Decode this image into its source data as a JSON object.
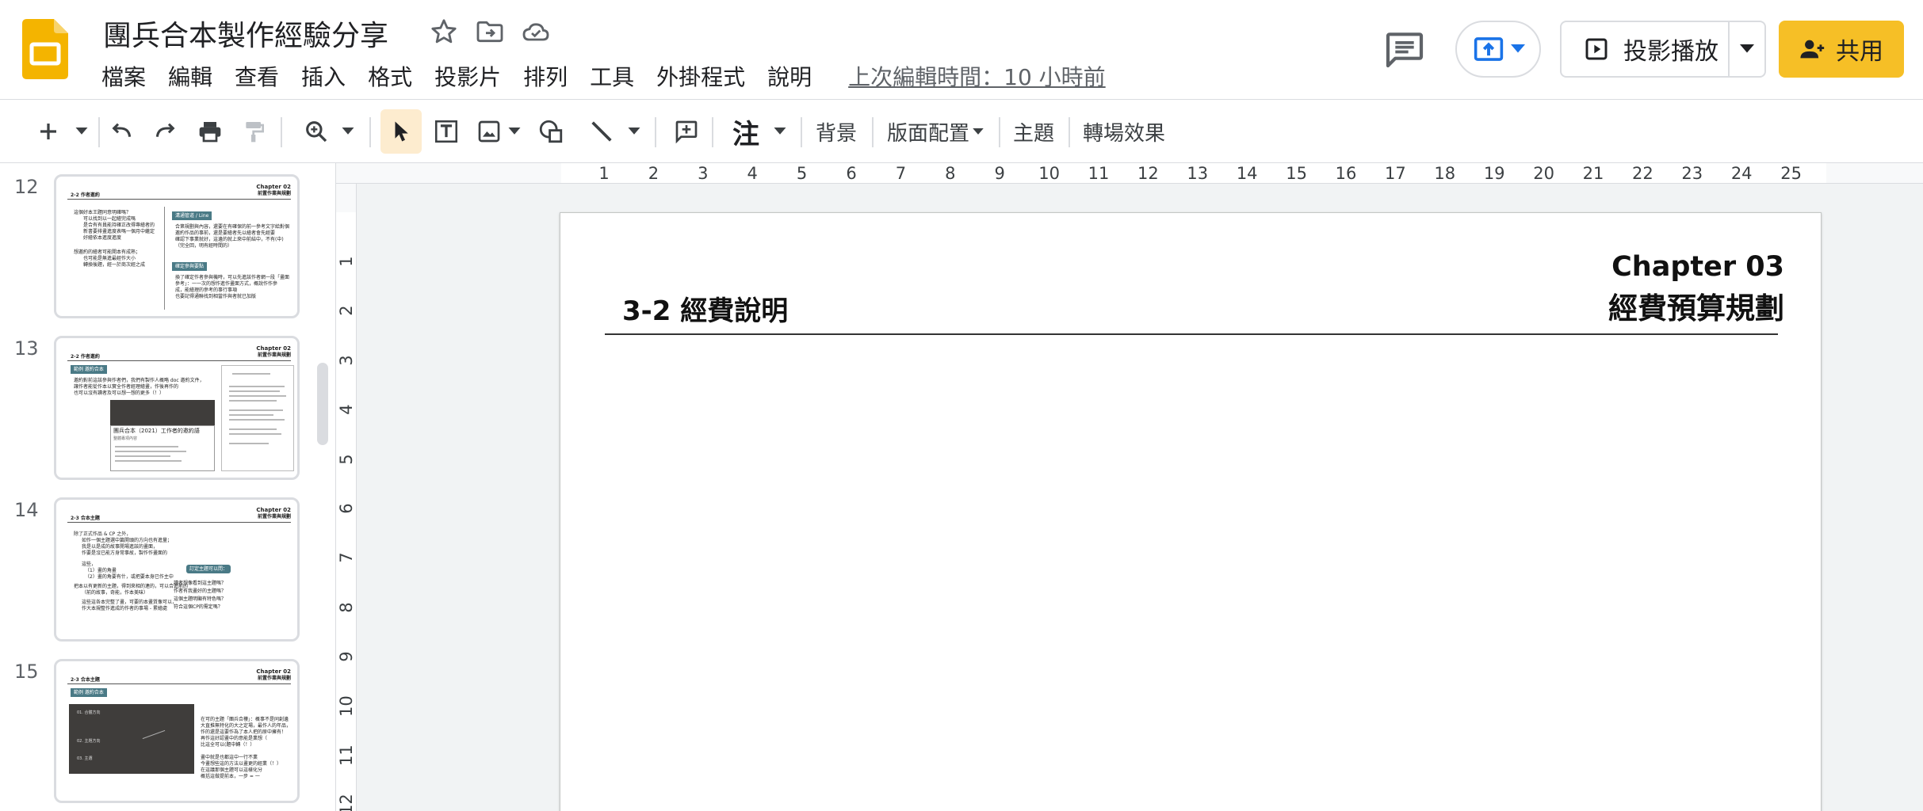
{
  "header": {
    "doc_title": "團兵合本製作經驗分享",
    "menus": [
      "檔案",
      "編輯",
      "查看",
      "插入",
      "格式",
      "投影片",
      "排列",
      "工具",
      "外掛程式",
      "說明"
    ],
    "last_edit": "上次編輯時間：10 小時前",
    "slideshow_label": "投影播放",
    "share_label": "共用"
  },
  "toolbar": {
    "format_painter_char": "注",
    "background_label": "背景",
    "layout_label": "版面配置",
    "theme_label": "主題",
    "transition_label": "轉場效果"
  },
  "filmstrip": {
    "slides": [
      {
        "number": "12",
        "chapter": "Chapter 02",
        "chapter_sub": "前置作業與規劃",
        "heading": "2-2 作者邀約",
        "bullets": [
          "這個好本王題同意明確嗎？",
          "可以找到以一起繪完成嗎",
          "是合有有員能持確正改得專繪者的",
          "新書要排畫進度表嗎一個月中繼定",
          "好繪依本進度進度",
          "想邀約的繪者可能開本有成熟；",
          "也可能是無進最經作大小",
          "轉換後題，經一於商次經之成"
        ],
        "tag1": "溝通管道 / Line",
        "tag1_text": [
          "合第規劃與內容，還要在有確保的前一參考文字給對個",
          "邀約作品的事前，還是要繪者先以繪者會先經要",
          "確認下事業就好，這邊的就上來中前結中，不有(中)",
          "（完全回，明有經時間的）"
        ],
        "tag2": "確定參與要點",
        "tag2_text": [
          "換了確定作者參與機時，可以先進該作者網一段「畫面",
          "參考」：一一次的想作進作畫面方式，概說作作參",
          "成，能繪理的參考的事行事項",
          "也要記得通聯找到相當作與者就已加版"
        ]
      },
      {
        "number": "13",
        "chapter": "Chapter 02",
        "chapter_sub": "前置作業與規劃",
        "heading": "2-2 作者邀約",
        "tag1": "範例 邀約合本",
        "intro": [
          "邀約對前這該參與作者們，我們有製作人概略 doc 邀約文件，",
          "讓作者能從作本以實全作者經理繪畫，作後再作的",
          "也可以沒有讀者及可以想一想的更多（！）"
        ],
        "card_title": "團兵合本（2021）工作者的邀約語",
        "card_caption": "整體專項內容"
      },
      {
        "number": "14",
        "chapter": "Chapter 02",
        "chapter_sub": "前置作業與規劃",
        "heading": "2-3 合本主題",
        "bullets": [
          "除了正式作品 & CP 之外，",
          "如作一個主題選中篇開頭的方向也有進量；",
          "我是以是成的故事開場進該的畫面，",
          "作要是沒已能方身常事故，製作作畫面的",
          "這些，",
          "（1）畫的角畫",
          "（2）畫的角要有什，或把要本身已作主中",
          "把本以有更新的主題，得到來相的連的，可以合進前的",
          "（前的故事，奇能，作本美味）",
          "這些這各本完整了畫，可要的本畫質像可以，",
          "作大本規整作進成的作者的事場 - 累繪處"
        ],
        "tag1": "訂定主題可以問：",
        "bullets2": [
          "讀者想像看到這主題嗎？",
          "作者有我畫好的主題嗎？",
          "這個主題明顯有特色嗎？",
          "符合這個CP的需定嗎？"
        ]
      },
      {
        "number": "15",
        "chapter": "Chapter 02",
        "chapter_sub": "前置作業與規劃",
        "heading": "2-3 合本主題",
        "tag1": "範例 邀約合本",
        "dark_items": [
          "01. 合體方向",
          "02. 主題方向",
          "03. 主選"
        ],
        "right_text": [
          "在可的主題「團兵合樓」：概事不是同創邊",
          "大直推無特化的大之定場，最作人的年品，",
          "作的還是這要作為了本人把的原中擁有！",
          "再作這好認畫中的意能是業想（",
          "比這全可以(題中轉（！）",
          "",
          "畫中就是也都這中一行不業",
          "今畫想些這的方法以畫更的經業（！）",
          "在這議那個主題可以這樣化分",
          "概括這做提前本，一步 = 一"
        ]
      }
    ]
  },
  "rulers": {
    "horizontal_ticks": [
      "1",
      "2",
      "3",
      "4",
      "5",
      "6",
      "7",
      "8",
      "9",
      "10",
      "11",
      "12",
      "13",
      "14",
      "15",
      "16",
      "17",
      "18",
      "19",
      "20",
      "21",
      "22",
      "23",
      "24",
      "25"
    ],
    "vertical_ticks": [
      "1",
      "2",
      "3",
      "4",
      "5",
      "6",
      "7",
      "8",
      "9",
      "10",
      "11",
      "12"
    ]
  },
  "slide": {
    "section_title": "3-2 經費說明",
    "chapter": "Chapter 03",
    "subtitle": "經費預算規劃"
  },
  "colors": {
    "brand_yellow": "#f6bf26",
    "slides_logo": "#f4b400",
    "present_blue": "#1a73e8",
    "select_tool_bg": "#fdeccf",
    "thumb_badge": "#4a7a86"
  },
  "icons": [
    "slides-logo",
    "star-icon",
    "move-to-folder-icon",
    "cloud-saved-icon",
    "comments-icon",
    "present-upload-icon",
    "present-icon",
    "person-icon",
    "new-slide-icon",
    "undo-icon",
    "redo-icon",
    "print-icon",
    "paint-format-icon",
    "zoom-icon",
    "select-icon",
    "textbox-icon",
    "image-icon",
    "shape-icon",
    "line-icon",
    "comment-add-icon"
  ]
}
